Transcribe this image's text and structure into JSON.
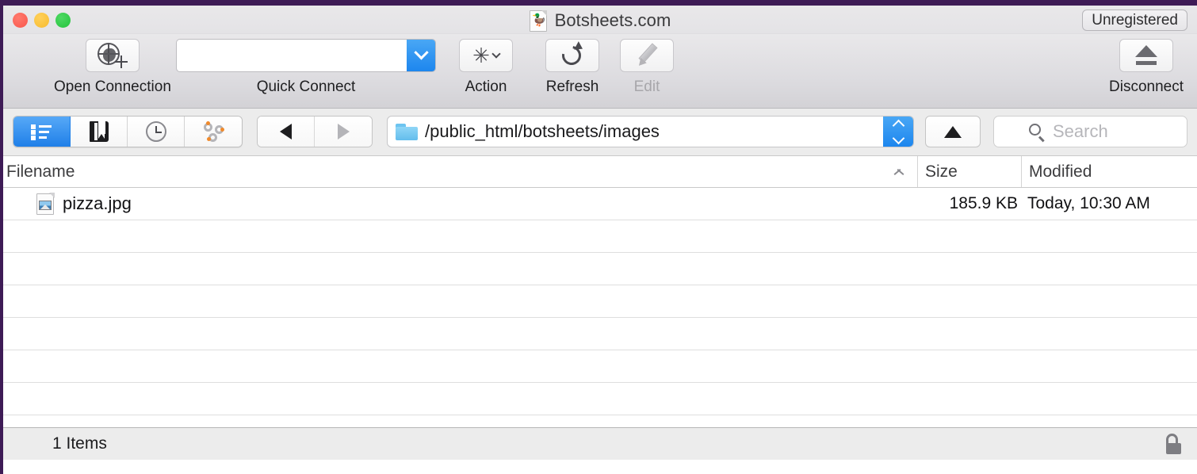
{
  "window": {
    "title": "Botsheets.com",
    "title_icon": "duck-document-icon",
    "license_badge": "Unregistered",
    "traffic_lights": [
      "close",
      "minimize",
      "zoom"
    ]
  },
  "toolbar": {
    "items": [
      {
        "label": "Open Connection",
        "icon": "globe-plus-icon",
        "disabled": false
      },
      {
        "label": "Action",
        "icon": "gear-icon",
        "disabled": false
      },
      {
        "label": "Refresh",
        "icon": "refresh-icon",
        "disabled": false
      },
      {
        "label": "Edit",
        "icon": "pencil-icon",
        "disabled": true
      },
      {
        "label": "Disconnect",
        "icon": "eject-icon",
        "disabled": false
      }
    ],
    "quick_connect": {
      "label": "Quick Connect",
      "value": "",
      "placeholder": ""
    }
  },
  "navbar": {
    "view_modes": [
      {
        "name": "browser",
        "icon": "list-view-icon",
        "selected": true
      },
      {
        "name": "bookmarks",
        "icon": "bookmark-icon",
        "selected": false
      },
      {
        "name": "history",
        "icon": "clock-icon",
        "selected": false
      },
      {
        "name": "connections",
        "icon": "bonjour-icon",
        "selected": false
      }
    ],
    "back_label": "Back",
    "forward_label": "Forward",
    "back_enabled": true,
    "forward_enabled": false,
    "path": "/public_html/botsheets/images",
    "up_label": "Up",
    "search": {
      "value": "",
      "placeholder": "Search"
    }
  },
  "filelist": {
    "columns": [
      {
        "key": "filename",
        "label": "Filename",
        "sorted": "asc"
      },
      {
        "key": "size",
        "label": "Size",
        "sorted": null
      },
      {
        "key": "modified",
        "label": "Modified",
        "sorted": null
      }
    ],
    "rows": [
      {
        "filename": "pizza.jpg",
        "icon": "jpeg-file-icon",
        "size": "185.9 KB",
        "modified": "Today, 10:30 AM"
      }
    ],
    "empty_row_count": 7
  },
  "statusbar": {
    "items_text": "1 Items",
    "security_icon": "unlocked-padlock-icon"
  },
  "colors": {
    "accent_blue": "#1d86ee",
    "desktop_strip": "#3e1b56",
    "toolbar_top": "#e9e8ea",
    "toolbar_bottom": "#d3d2d6",
    "chrome_gray": "#ececec",
    "folder_blue": "#63bdec"
  }
}
